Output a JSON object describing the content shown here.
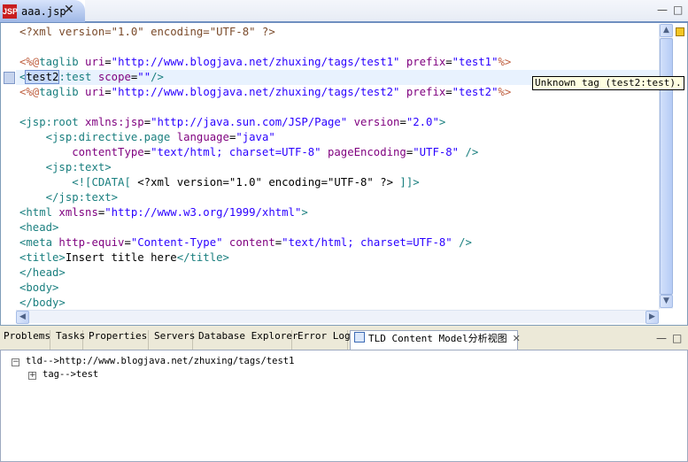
{
  "editor": {
    "tab": {
      "icon_text": "JSP",
      "label": "aaa.jsp",
      "close": "✕"
    },
    "window_controls": {
      "minimize": "—",
      "maximize": "□"
    },
    "code_lines": [
      [
        [
          "pi",
          "<?xml version=\"1.0\" encoding=\"UTF-8\" ?>"
        ]
      ],
      [],
      [
        [
          "dir",
          "<%@"
        ],
        [
          "tag",
          "taglib "
        ],
        [
          "att",
          "uri"
        ],
        [
          "",
          "="
        ],
        [
          "str",
          "\"http://www.blogjava.net/zhuxing/tags/test1\""
        ],
        [
          "",
          ""
        ],
        [
          "att",
          " prefix"
        ],
        [
          "",
          "="
        ],
        [
          "str",
          "\"test1\""
        ],
        [
          "dir",
          "%>"
        ]
      ],
      [
        [
          "tag",
          "<"
        ],
        [
          "sel",
          "test2"
        ],
        [
          "tag",
          ":test "
        ],
        [
          "att",
          "scope"
        ],
        [
          "",
          "="
        ],
        [
          "str",
          "\"\""
        ],
        [
          "tag",
          "/>"
        ]
      ],
      [
        [
          "dir",
          "<%@"
        ],
        [
          "tag",
          "taglib "
        ],
        [
          "att",
          "uri"
        ],
        [
          "",
          "="
        ],
        [
          "str",
          "\"http://www.blogjava.net/zhuxing/tags/test2\""
        ],
        [
          "att",
          " prefix"
        ],
        [
          "",
          "="
        ],
        [
          "str",
          "\"test2\""
        ],
        [
          "dir",
          "%>"
        ]
      ],
      [],
      [
        [
          "tag",
          "<jsp:root "
        ],
        [
          "att",
          "xmlns:jsp"
        ],
        [
          "",
          "="
        ],
        [
          "str",
          "\"http://java.sun.com/JSP/Page\""
        ],
        [
          "att",
          " version"
        ],
        [
          "",
          "="
        ],
        [
          "str",
          "\"2.0\""
        ],
        [
          "tag",
          ">"
        ]
      ],
      [
        [
          "",
          "    "
        ],
        [
          "tag",
          "<jsp:directive.page "
        ],
        [
          "att",
          "language"
        ],
        [
          "",
          "="
        ],
        [
          "str",
          "\"java\""
        ]
      ],
      [
        [
          "",
          "        "
        ],
        [
          "att",
          "contentType"
        ],
        [
          "",
          "="
        ],
        [
          "str",
          "\"text/html; charset=UTF-8\""
        ],
        [
          "att",
          " pageEncoding"
        ],
        [
          "",
          "="
        ],
        [
          "str",
          "\"UTF-8\""
        ],
        [
          "tag",
          " />"
        ]
      ],
      [
        [
          "",
          "    "
        ],
        [
          "tag",
          "<jsp:text>"
        ]
      ],
      [
        [
          "",
          "        "
        ],
        [
          "tag",
          "<![CDATA["
        ],
        [
          "",
          " <?xml version=\"1.0\" encoding=\"UTF-8\" ?> "
        ],
        [
          "tag",
          "]]>"
        ]
      ],
      [
        [
          "",
          "    "
        ],
        [
          "tag",
          "</jsp:text>"
        ]
      ],
      [
        [
          "tag",
          "<html "
        ],
        [
          "att",
          "xmlsns"
        ],
        [
          "",
          "="
        ],
        [
          "str",
          "\"http://www.w3.org/1999/xhtml\""
        ],
        [
          "tag",
          ">"
        ]
      ],
      [
        [
          "tag",
          "<head>"
        ]
      ],
      [
        [
          "tag",
          "<meta "
        ],
        [
          "att",
          "http-equiv"
        ],
        [
          "",
          "="
        ],
        [
          "str",
          "\"Content-Type\""
        ],
        [
          "att",
          " content"
        ],
        [
          "",
          "="
        ],
        [
          "str",
          "\"text/html; charset=UTF-8\""
        ],
        [
          "tag",
          " />"
        ]
      ],
      [
        [
          "tag",
          "<title>"
        ],
        [
          "",
          "Insert title here"
        ],
        [
          "tag",
          "</title>"
        ]
      ],
      [
        [
          "tag",
          "</head>"
        ]
      ],
      [
        [
          "tag",
          "<body>"
        ]
      ],
      [
        [
          "tag",
          "</body>"
        ]
      ]
    ],
    "highlighted_line": 3,
    "tooltip": "Unknown tag (test2:test).",
    "scroll_up": "▲",
    "scroll_down": "▼",
    "scroll_left": "◀",
    "scroll_right": "▶"
  },
  "views": {
    "tabs": [
      {
        "label": "Problems",
        "active": false
      },
      {
        "label": "Tasks",
        "active": false
      },
      {
        "label": "Properties",
        "active": false
      },
      {
        "label": "Servers",
        "active": false
      },
      {
        "label": "Database Explorer",
        "active": false
      },
      {
        "label": "Error Log",
        "active": false
      },
      {
        "label": "TLD Content Model分析视图",
        "active": true,
        "close": "✕"
      }
    ],
    "window_controls": {
      "minimize": "—",
      "maximize": "□"
    },
    "tree": [
      {
        "toggle": "−",
        "label": "tld-->http://www.blogjava.net/zhuxing/tags/test1",
        "depth": 0
      },
      {
        "toggle": "+",
        "label": "tag-->test",
        "depth": 1
      }
    ]
  },
  "colors": {
    "tag": "#1a7f7f",
    "attribute": "#7f007f",
    "string": "#2a00ff",
    "directive": "#bf5f3f"
  }
}
